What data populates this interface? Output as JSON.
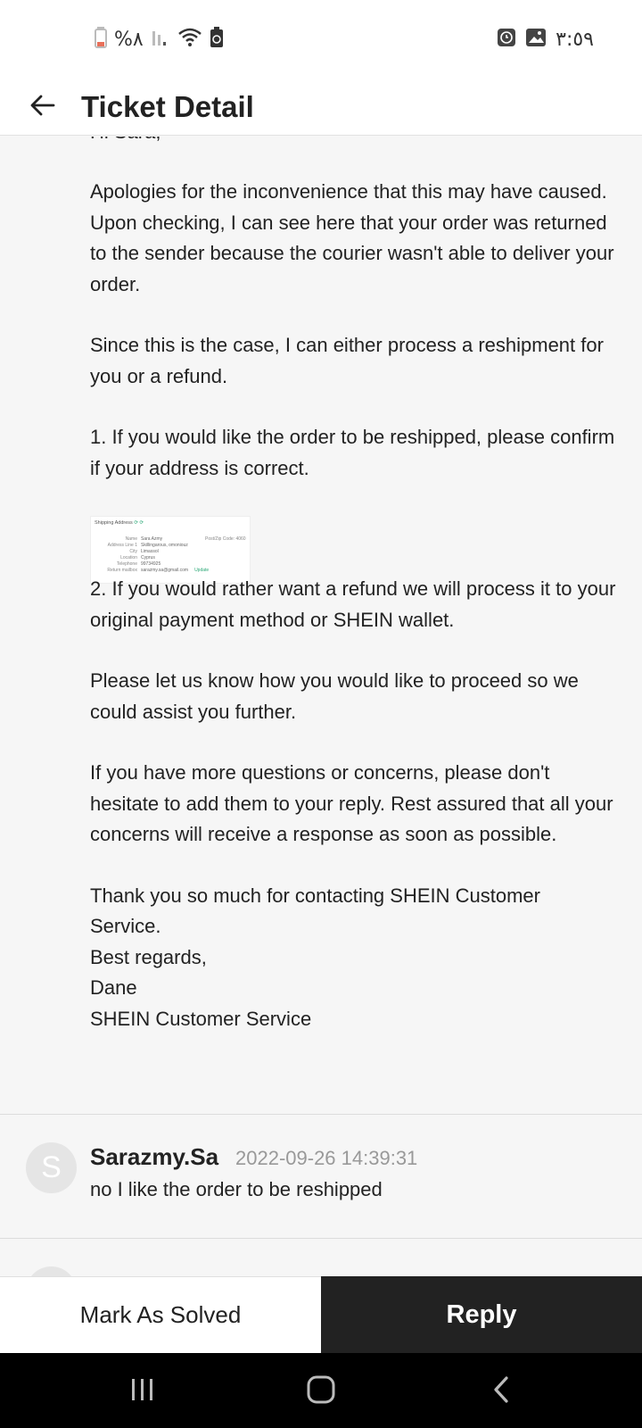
{
  "status_bar": {
    "battery_percent": "%٨",
    "time": "٣:٥٩",
    "icons": [
      "battery-icon",
      "signal-icon",
      "wifi-icon",
      "battery-saver-icon",
      "alarm-icon",
      "gallery-icon"
    ]
  },
  "header": {
    "title": "Ticket Detail",
    "back_icon": "arrow-left-icon"
  },
  "message": {
    "greeting_partial": "Hi Sara,",
    "paragraphs": [
      "Apologies for the inconvenience that this may have caused. Upon checking, I can see here that your order was returned to the sender because the courier wasn't able to deliver your order.",
      "Since this is the case, I can either process a reshipment for you or a refund.",
      "1. If you would like the order to be reshipped, please confirm if your address is correct.",
      "2. If you would rather want a refund we will process it to your original payment method or SHEIN wallet.",
      "Please let us know how you would like to proceed so we could assist you further.",
      "If you have more questions or concerns, please don't hesitate to add them to your reply. Rest assured that all your concerns will receive a response as soon as possible."
    ],
    "signoff": [
      "Thank you so much for contacting SHEIN Customer Service.",
      "Best regards,",
      "Dane",
      "SHEIN Customer Service"
    ]
  },
  "attachment": {
    "title": "Shipping Address",
    "rows": [
      {
        "k": "Name",
        "v": "Sara Azmy"
      },
      {
        "k": "Address Line 1",
        "v": "Skillingarous, omoniouz"
      },
      {
        "k": "City",
        "v": "Limassol"
      },
      {
        "k": "Location",
        "v": "Cyprus"
      },
      {
        "k": "Telephone",
        "v": "99734925"
      },
      {
        "k": "Return mailbox",
        "v": "sarazmy.sa@gmail.com"
      }
    ],
    "zip": "Post/Zip Code: 4060",
    "update_label": "Update"
  },
  "replies": [
    {
      "avatar_letter": "S",
      "author": "Sarazmy.Sa",
      "time": "2022-09-26 14:39:31",
      "text": "no I like the order to be reshipped"
    }
  ],
  "actions": {
    "mark_solved": "Mark As Solved",
    "reply": "Reply"
  },
  "nav": {
    "icons": [
      "recent-apps-icon",
      "home-icon",
      "back-icon"
    ]
  }
}
